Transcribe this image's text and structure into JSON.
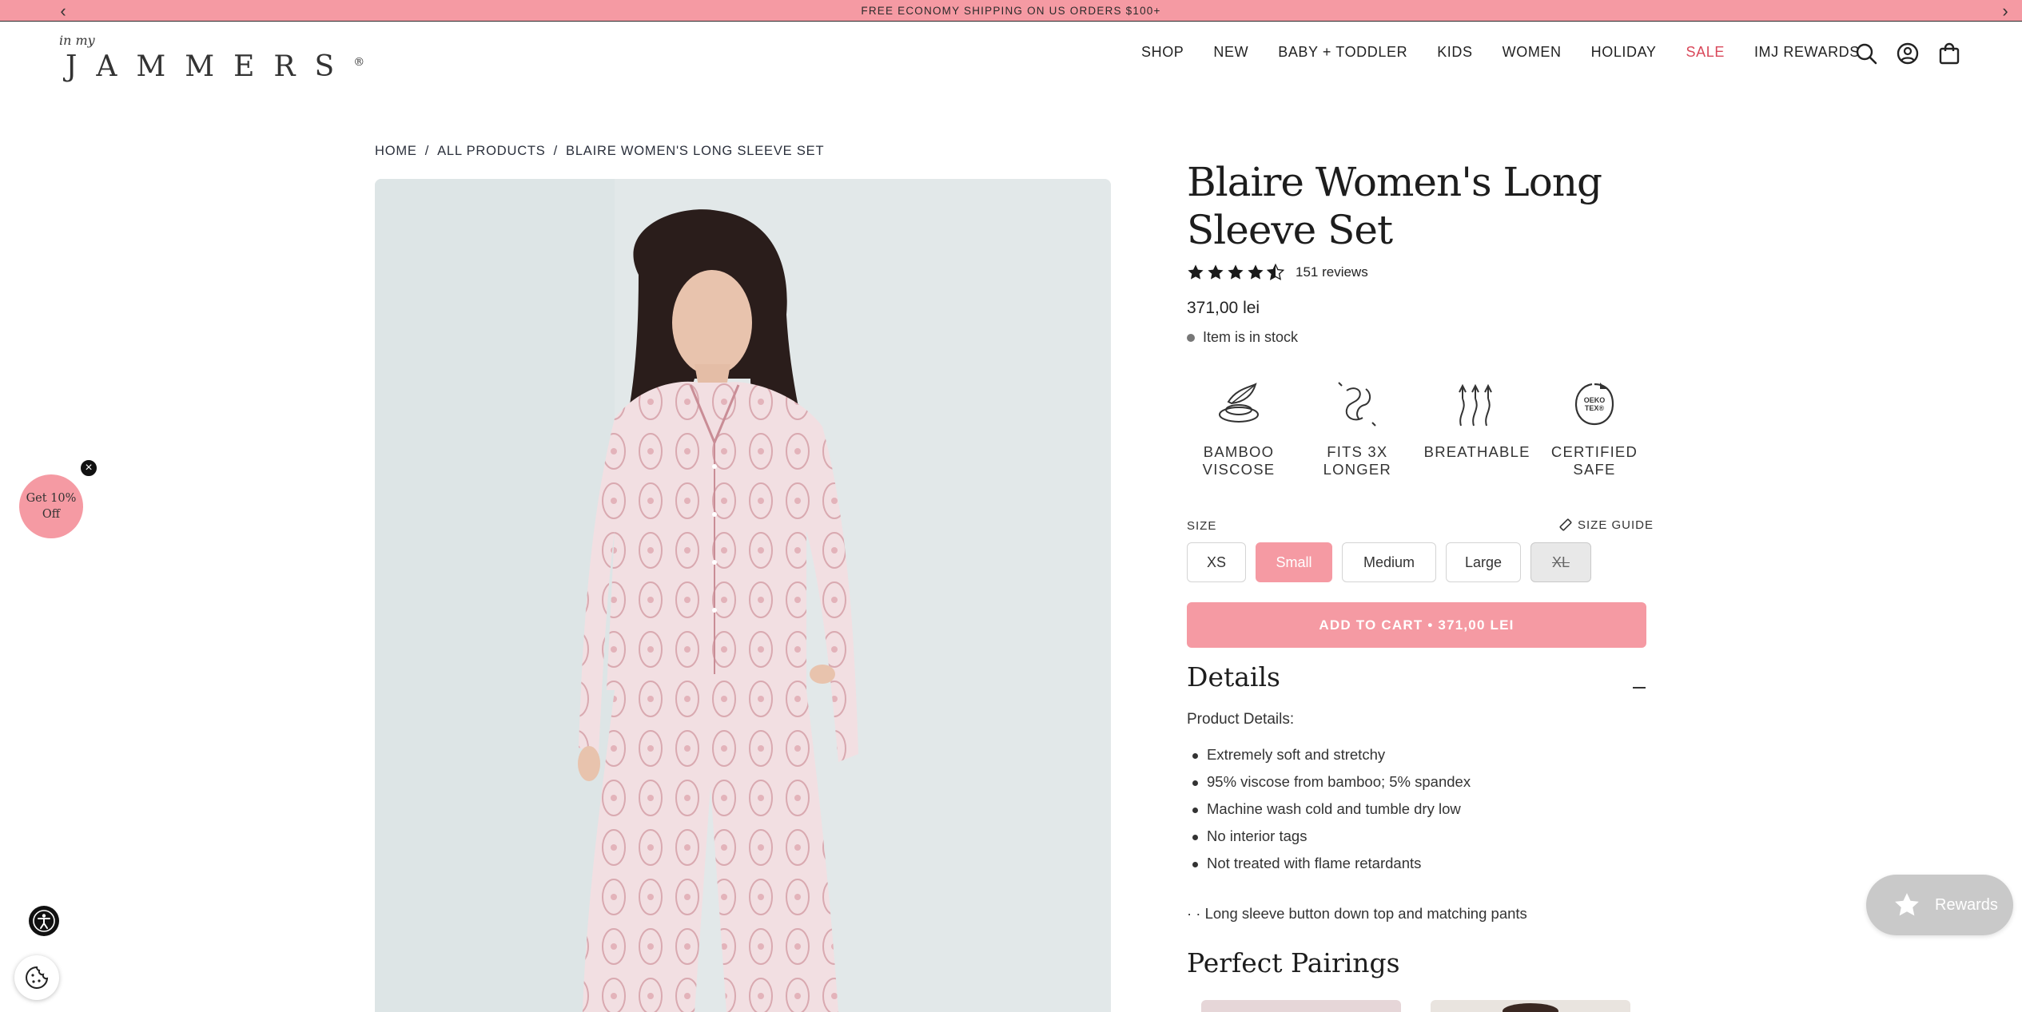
{
  "announcement": {
    "text": "FREE ECONOMY SHIPPING ON US ORDERS $100+"
  },
  "logo": {
    "small": "in my",
    "big": "JAMMERS",
    "mark": "®"
  },
  "nav": [
    "SHOP",
    "NEW",
    "BABY + TODDLER",
    "KIDS",
    "WOMEN",
    "HOLIDAY",
    "SALE",
    "IMJ REWARDS"
  ],
  "header_icons": [
    "search-icon",
    "account-icon",
    "bag-icon"
  ],
  "breadcrumb": [
    "HOME",
    "ALL PRODUCTS",
    "BLAIRE WOMEN'S LONG SLEEVE SET"
  ],
  "product": {
    "title": "Blaire Women's Long Sleeve Set",
    "rating": 4.5,
    "reviews": "151 reviews",
    "price": "371,00 lei",
    "stock": "Item is in stock"
  },
  "features": [
    {
      "icon": "bamboo-icon",
      "label": "BAMBOO VISCOSE"
    },
    {
      "icon": "stretch-icon",
      "label": "FITS 3X LONGER"
    },
    {
      "icon": "breathable-icon",
      "label": "BREATHABLE"
    },
    {
      "icon": "oeko-tex-icon",
      "label": "CERTIFIED SAFE"
    }
  ],
  "size": {
    "label": "SIZE",
    "guide": "SIZE GUIDE",
    "options": [
      "XS",
      "Small",
      "Medium",
      "Large",
      "XL"
    ],
    "selected": "Small",
    "unavailable": [
      "XL"
    ]
  },
  "cart": {
    "label": "ADD TO CART • 371,00 LEI"
  },
  "details": {
    "heading": "Details",
    "subheading": "Product Details:",
    "items": [
      "Extremely soft and stretchy",
      "95% viscose from bamboo; 5% spandex",
      "Machine wash cold and tumble dry low",
      "No interior tags",
      "Not treated with flame retardants"
    ],
    "note": "· · Long sleeve button down top and matching pants"
  },
  "pairings": {
    "heading": "Perfect Pairings"
  },
  "popup": {
    "line1": "Get 10%",
    "line2": "Off"
  },
  "rewards": {
    "label": "Rewards"
  },
  "colors": {
    "accent": "#f59aa3",
    "sale": "#d9485a"
  }
}
